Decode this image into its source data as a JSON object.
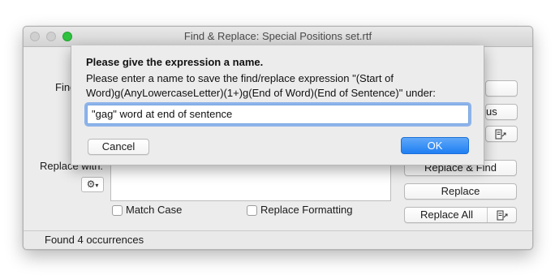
{
  "window": {
    "title": "Find & Replace: Special Positions set.rtf"
  },
  "find": {
    "label_partial": "Find"
  },
  "replace": {
    "label": "Replace with:"
  },
  "buttons": {
    "previous_partial": "us",
    "replace_and_find": "Replace & Find",
    "replace": "Replace",
    "replace_all": "Replace All"
  },
  "options": {
    "match_case": "Match Case",
    "replace_formatting": "Replace Formatting"
  },
  "status": {
    "text": "Found 4 occurrences"
  },
  "dialog": {
    "title": "Please give the expression a name.",
    "message": "Please enter a name to save the find/replace expression \"(Start of Word)g(AnyLowercaseLetter)(1+)g(End of Word)(End of Sentence)\" under:",
    "input_value": "\"gag\" word at end of sentence",
    "cancel_label": "Cancel",
    "ok_label": "OK"
  },
  "icons": {
    "gear": "gear-icon",
    "chevron": "chevron-down-icon",
    "detach": "detach-window-icon"
  },
  "colors": {
    "accent": "#1f7ff3",
    "zoom_button": "#2ec23f",
    "focus_ring": "#8db3ea"
  }
}
